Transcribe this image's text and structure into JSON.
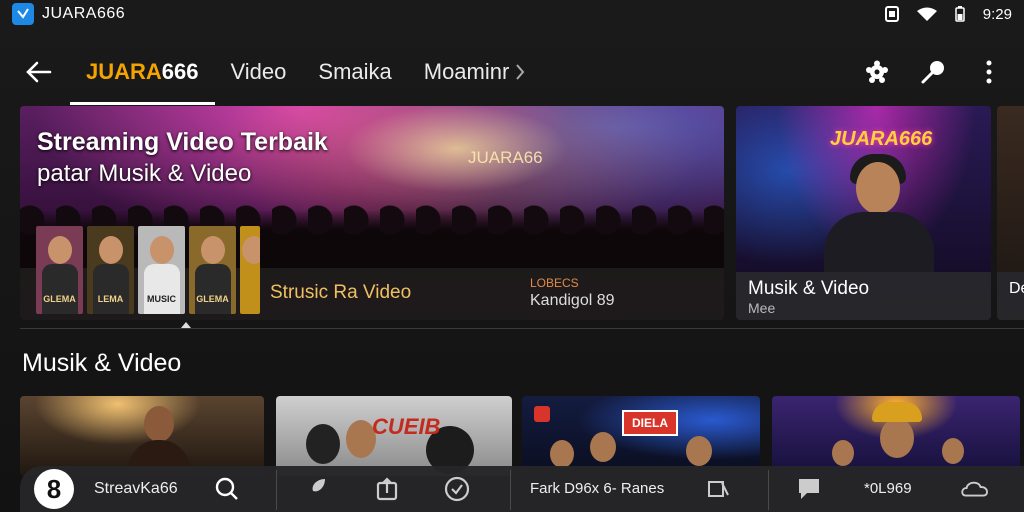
{
  "status_bar": {
    "app_icon": "app-logo-icon",
    "app_title": "JUARA666",
    "time": "9:29",
    "icons": [
      "screenshot-icon",
      "wifi-icon",
      "battery-icon"
    ]
  },
  "nav": {
    "back_icon": "arrow-left-icon",
    "tabs": [
      {
        "label_prefix": "JUARA",
        "label_suffix": "666"
      },
      {
        "label": "Video"
      },
      {
        "label": "Smaika"
      },
      {
        "label": "Moaminr"
      }
    ],
    "actions": [
      "settings-icon",
      "microphone-icon",
      "more-vertical-icon"
    ]
  },
  "hero": {
    "title_line1": "Streaming Video Terbaik",
    "title_line2": "patar Musik & Video",
    "brand": "JUARA66",
    "caption": "Strusic Ra Video",
    "meta_label": "LOBECS",
    "meta_value": "Kandigol 89",
    "thumbnails": [
      {
        "label": "GLEMA",
        "bg": "#7a3b55"
      },
      {
        "label": "LEMA",
        "bg": "#4a3a1e"
      },
      {
        "label": "MUSIC",
        "bg": "#b9b9b9"
      },
      {
        "label": "GLEMA",
        "bg": "#8a6a2a"
      },
      {
        "label": "",
        "bg": "#c0901a"
      }
    ]
  },
  "side_card": {
    "brand": "JUARA666",
    "title": "Musik & Video",
    "subtitle": "Mee"
  },
  "peek_card": {
    "text": "De"
  },
  "section": {
    "title": "Musik & Video",
    "cards": [
      {
        "label": ""
      },
      {
        "label": "CUEIB"
      },
      {
        "label": "DIELA"
      },
      {
        "label": ""
      }
    ]
  },
  "bottom_bar": {
    "avatar": "8",
    "user_label": "StreavKa66",
    "center_text": "Fark D96x 6- Ranes",
    "right_text": "*0L969",
    "icons": [
      "search-icon",
      "rocket-icon",
      "upload-icon",
      "compass-icon",
      "bookmark-icon",
      "chat-icon",
      "cloud-icon"
    ]
  }
}
